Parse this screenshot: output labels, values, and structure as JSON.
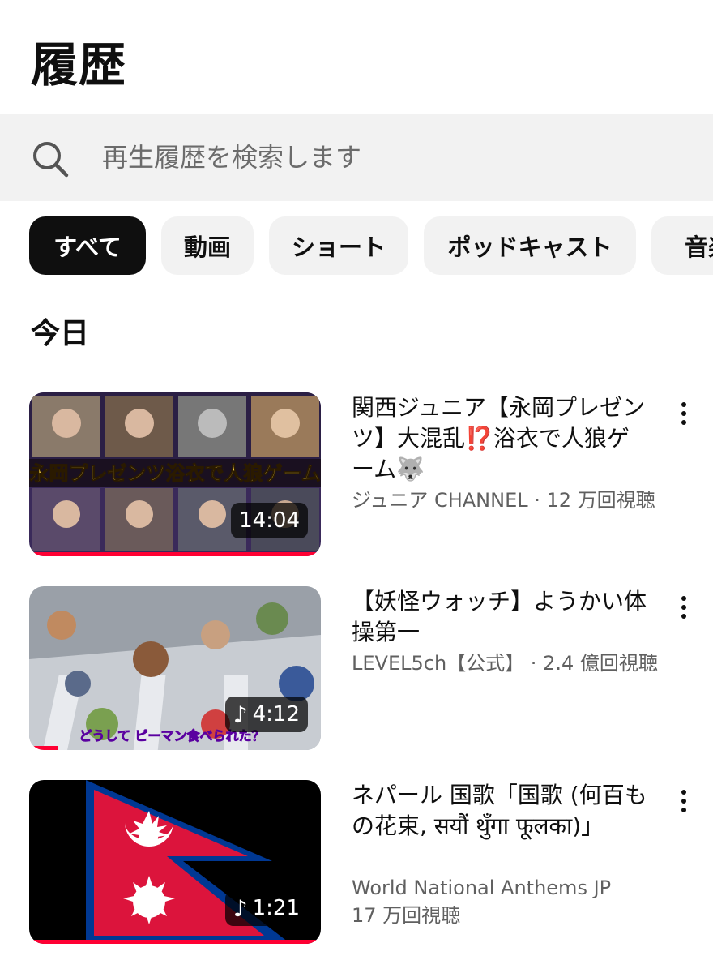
{
  "page": {
    "title": "履歴"
  },
  "search": {
    "placeholder": "再生履歴を検索します"
  },
  "chips": [
    {
      "label": "すべて",
      "active": true
    },
    {
      "label": "動画",
      "active": false
    },
    {
      "label": "ショート",
      "active": false
    },
    {
      "label": "ポッドキャスト",
      "active": false
    },
    {
      "label": "音楽",
      "active": false
    }
  ],
  "section": {
    "title": "今日"
  },
  "videos": [
    {
      "title_a": "関西ジュニア【永岡プレゼンツ】大混乱",
      "title_emoji1": "⁉️",
      "title_b": "浴衣で人狼ゲーム",
      "title_emoji2": "🐺",
      "channel": "ジュニア CHANNEL",
      "views": "12 万回視聴",
      "duration": "14:04",
      "thumb_banner": "永岡プレゼンツ浴衣で人狼ゲーム",
      "progress": 1.0
    },
    {
      "title": "【妖怪ウォッチ】ようかい体操第一",
      "channel": "LEVEL5ch【公式】",
      "views": "2.4 億回視聴",
      "duration": "4:12",
      "thumb_caption": "どうして ピーマン食べられた？",
      "progress": 0.1
    },
    {
      "title": "ネパール 国歌「国歌 (何百もの花束, सयौं थुँगा फूलका)」",
      "channel": "World National Anthems JP",
      "views": "17 万回視聴",
      "duration": "1:21",
      "progress": 1.0
    }
  ],
  "colors": {
    "progress": "#ff0033",
    "chip_active": "#0f0f0f",
    "chip_bg": "#f2f2f2",
    "nepal_red": "#dc143c",
    "nepal_blue": "#003893"
  },
  "icons": {
    "search": "search-icon",
    "more": "more-vert-icon",
    "music": "music-note-icon"
  }
}
